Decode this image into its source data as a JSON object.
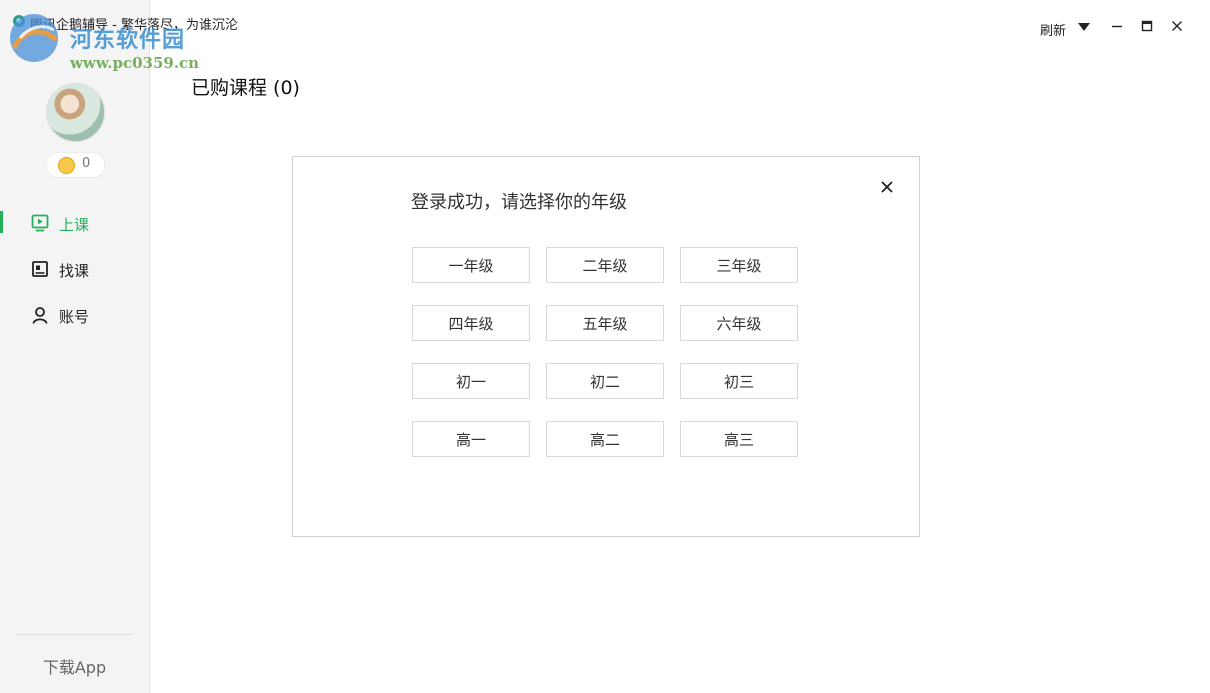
{
  "window": {
    "title": "腾讯企鹅辅导 - 繁华落尽，为谁沉沦",
    "refresh_label": "刷新"
  },
  "watermark": {
    "text": "河东软件园",
    "url": "www.pc0359.cn"
  },
  "sidebar": {
    "coin_count": "0",
    "items": [
      {
        "label": "上课",
        "icon": "play-screen-icon",
        "active": true
      },
      {
        "label": "找课",
        "icon": "book-icon",
        "active": false
      },
      {
        "label": "账号",
        "icon": "person-icon",
        "active": false
      }
    ],
    "download_label": "下载App"
  },
  "main": {
    "page_title": "已购课程 (0)"
  },
  "dialog": {
    "title": "登录成功，请选择你的年级",
    "grades": [
      [
        "一年级",
        "二年级",
        "三年级"
      ],
      [
        "四年级",
        "五年级",
        "六年级"
      ],
      [
        "初一",
        "初二",
        "初三"
      ],
      [
        "高一",
        "高二",
        "高三"
      ]
    ]
  },
  "colors": {
    "accent": "#23b15c",
    "sidebar_bg": "#f4f4f4",
    "coin": "#f7c948"
  }
}
